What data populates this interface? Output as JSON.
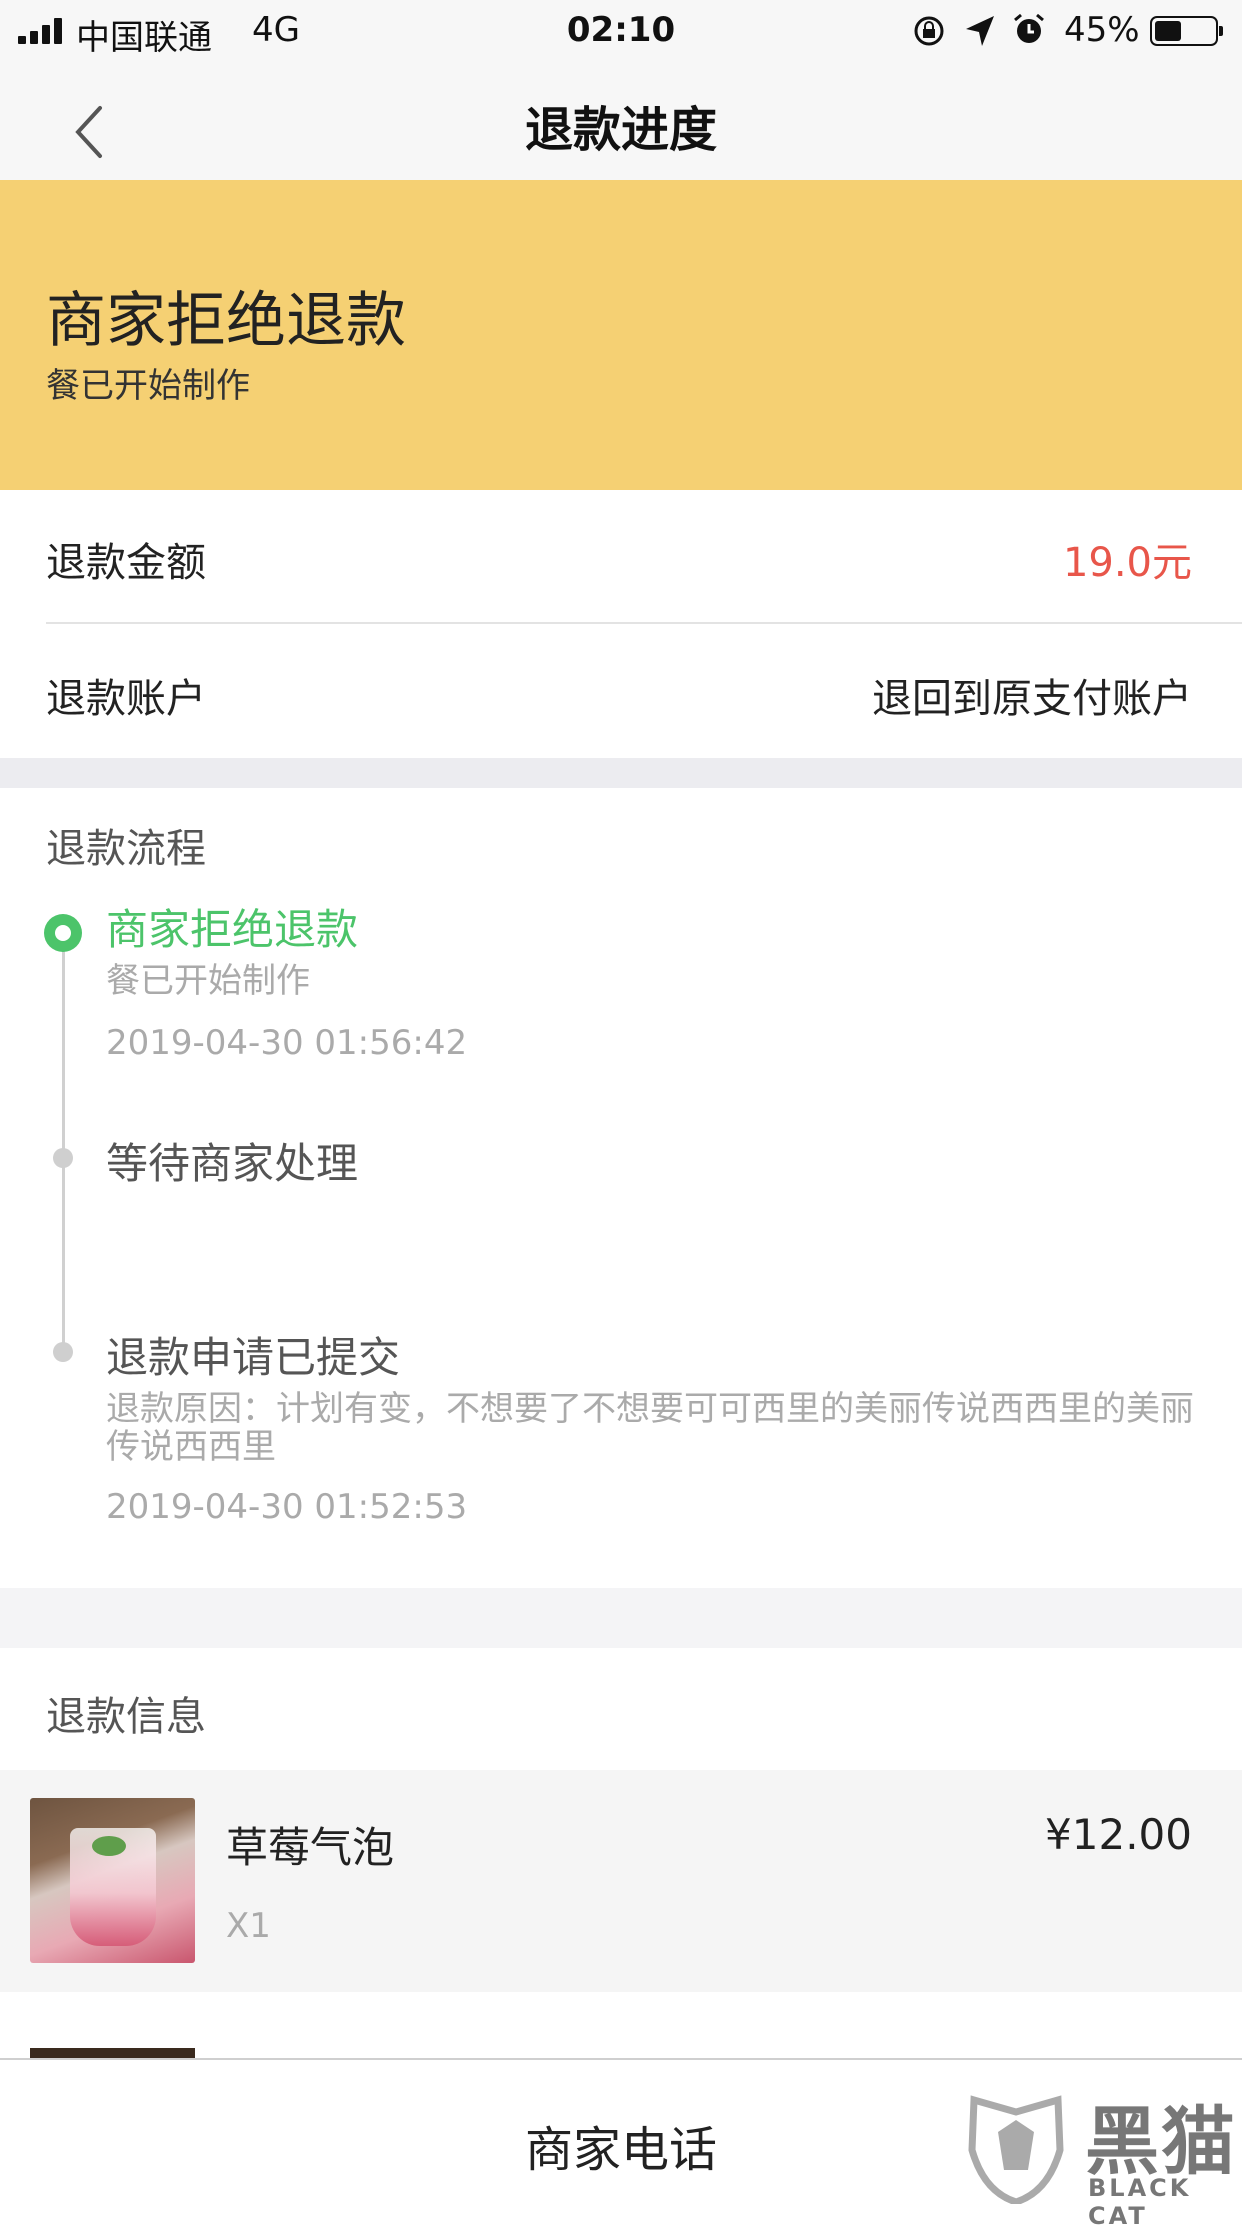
{
  "status_bar": {
    "carrier": "中国联通",
    "network": "4G",
    "time": "02:10",
    "battery": "45%",
    "battery_level": 0.45,
    "icons": [
      "signal-icon",
      "orientation-lock-icon",
      "location-icon",
      "alarm-icon",
      "battery-icon"
    ]
  },
  "nav": {
    "title": "退款进度",
    "back_icon": "chevron-left-icon"
  },
  "banner": {
    "title": "商家拒绝退款",
    "subtitle": "餐已开始制作",
    "background": "#f5d073"
  },
  "refund": {
    "amount_label": "退款金额",
    "amount_value": "19.0元",
    "amount_color": "#e8564a",
    "account_label": "退款账户",
    "account_value": "退回到原支付账户"
  },
  "process": {
    "title": "退款流程",
    "accent": "#4cc46a",
    "steps": [
      {
        "title": "商家拒绝退款",
        "detail": "餐已开始制作",
        "time": "2019-04-30 01:56:42"
      },
      {
        "title": "等待商家处理"
      },
      {
        "title": "退款申请已提交",
        "detail": "退款原因：计划有变，不想要了不想要可可西里的美丽传说西西里的美丽传说西西里",
        "time": "2019-04-30 01:52:53"
      }
    ]
  },
  "refund_info": {
    "title": "退款信息",
    "items": [
      {
        "name": "草莓气泡",
        "qty": "X1",
        "price": "¥12.00"
      }
    ]
  },
  "bottom": {
    "phone_button": "商家电话"
  },
  "watermark": {
    "text": "黑猫",
    "sub": "BLACK CAT"
  }
}
